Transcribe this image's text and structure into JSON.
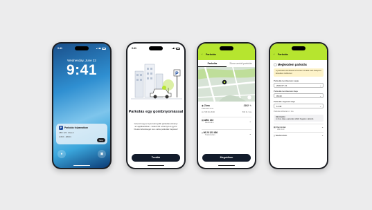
{
  "phone1": {
    "status_time": "9:41",
    "date": "Wednesday, June 22",
    "time": "9:41",
    "notification": {
      "app_letter": "P",
      "title": "Parkolás folyamatban",
      "plate": "ABC 123",
      "zone": "Zóna 1",
      "duration": "1:08 h",
      "price": "480 Ft",
      "stop_label": "Stop"
    }
  },
  "phone2": {
    "status_time": "9:41",
    "title": "Parkolás egy gombnyomással",
    "text": "Ismerd meg az új és könnyebb parkolási élményt az applikációban - fedezd fel a könnyű és gyors fizetési lehetőséget és a valós parkolási helyeket!",
    "cta": "Tovább"
  },
  "phone3": {
    "back_icon": "chevron-left-icon",
    "title": "Parkolás",
    "tabs": [
      "Parkolás",
      "Zóna szerinti parkolás"
    ],
    "zone_name": "Zóna",
    "zone_code": "2102",
    "zone_sub": "Parkolási zóna",
    "zone_info": "H-P 08:00-18:00",
    "zone_price": "500 Ft / óra",
    "plate": "ABC 123",
    "plate_sub": "Rendszám",
    "phone": "06 20 123 456",
    "phone_sub": "Telefonszám",
    "cta": "Megváltom"
  },
  "phone4": {
    "title": "Megkezdem parkolás",
    "warning": "A parkolás elindítását a fizetési zónába való belépést követően indítsd el.",
    "date_label": "Parkolás kezdetének napja",
    "date_value": "2022.07.13.",
    "start_label": "Parkolás kezdetének ideje",
    "start_value": "09:40",
    "end_label": "Parkolás végének ideje",
    "end_value": "11:40",
    "hint": "Parkolási időtartam: 2 óra",
    "info_title": "Információ",
    "info_text": "A zóna díja a parkolási időtől függően változik.",
    "row1_label": "Rendszám",
    "row1_value": "ABC 123",
    "row2_label": "Telefonszám",
    "row2_value": "06 20 123 456"
  }
}
